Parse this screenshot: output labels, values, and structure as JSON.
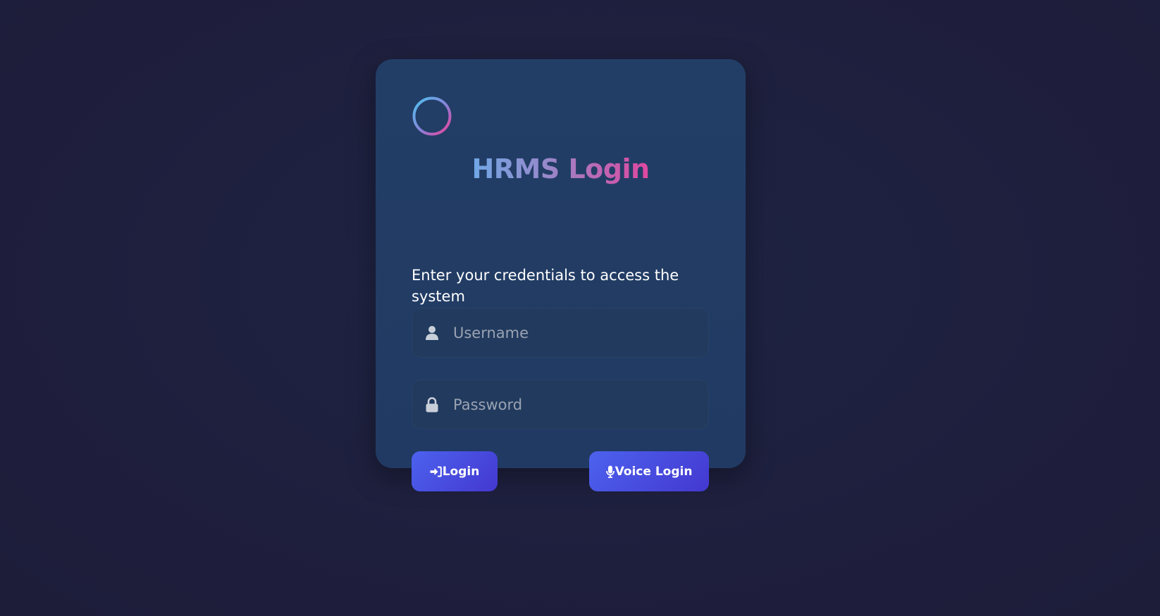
{
  "login": {
    "title_part1": "HRMS",
    "title_part2": "Login",
    "subtitle": "Enter your credentials to access the system",
    "username": {
      "placeholder": "Username",
      "value": "",
      "icon": "user-icon"
    },
    "password": {
      "placeholder": "Password",
      "value": "",
      "icon": "lock-icon"
    },
    "login_button": {
      "label": "Login",
      "icon": "sign-in-icon"
    },
    "voice_button": {
      "label": "Voice Login",
      "icon": "microphone-icon"
    },
    "logo_icon": "plus-circle-icon"
  },
  "colors": {
    "background": "#1e1f3d",
    "card": "#223e66",
    "button_start": "#4c62ee",
    "button_end": "#4438d0",
    "title_gradient_start": "#6fa8e6",
    "title_gradient_end": "#e0479f"
  }
}
